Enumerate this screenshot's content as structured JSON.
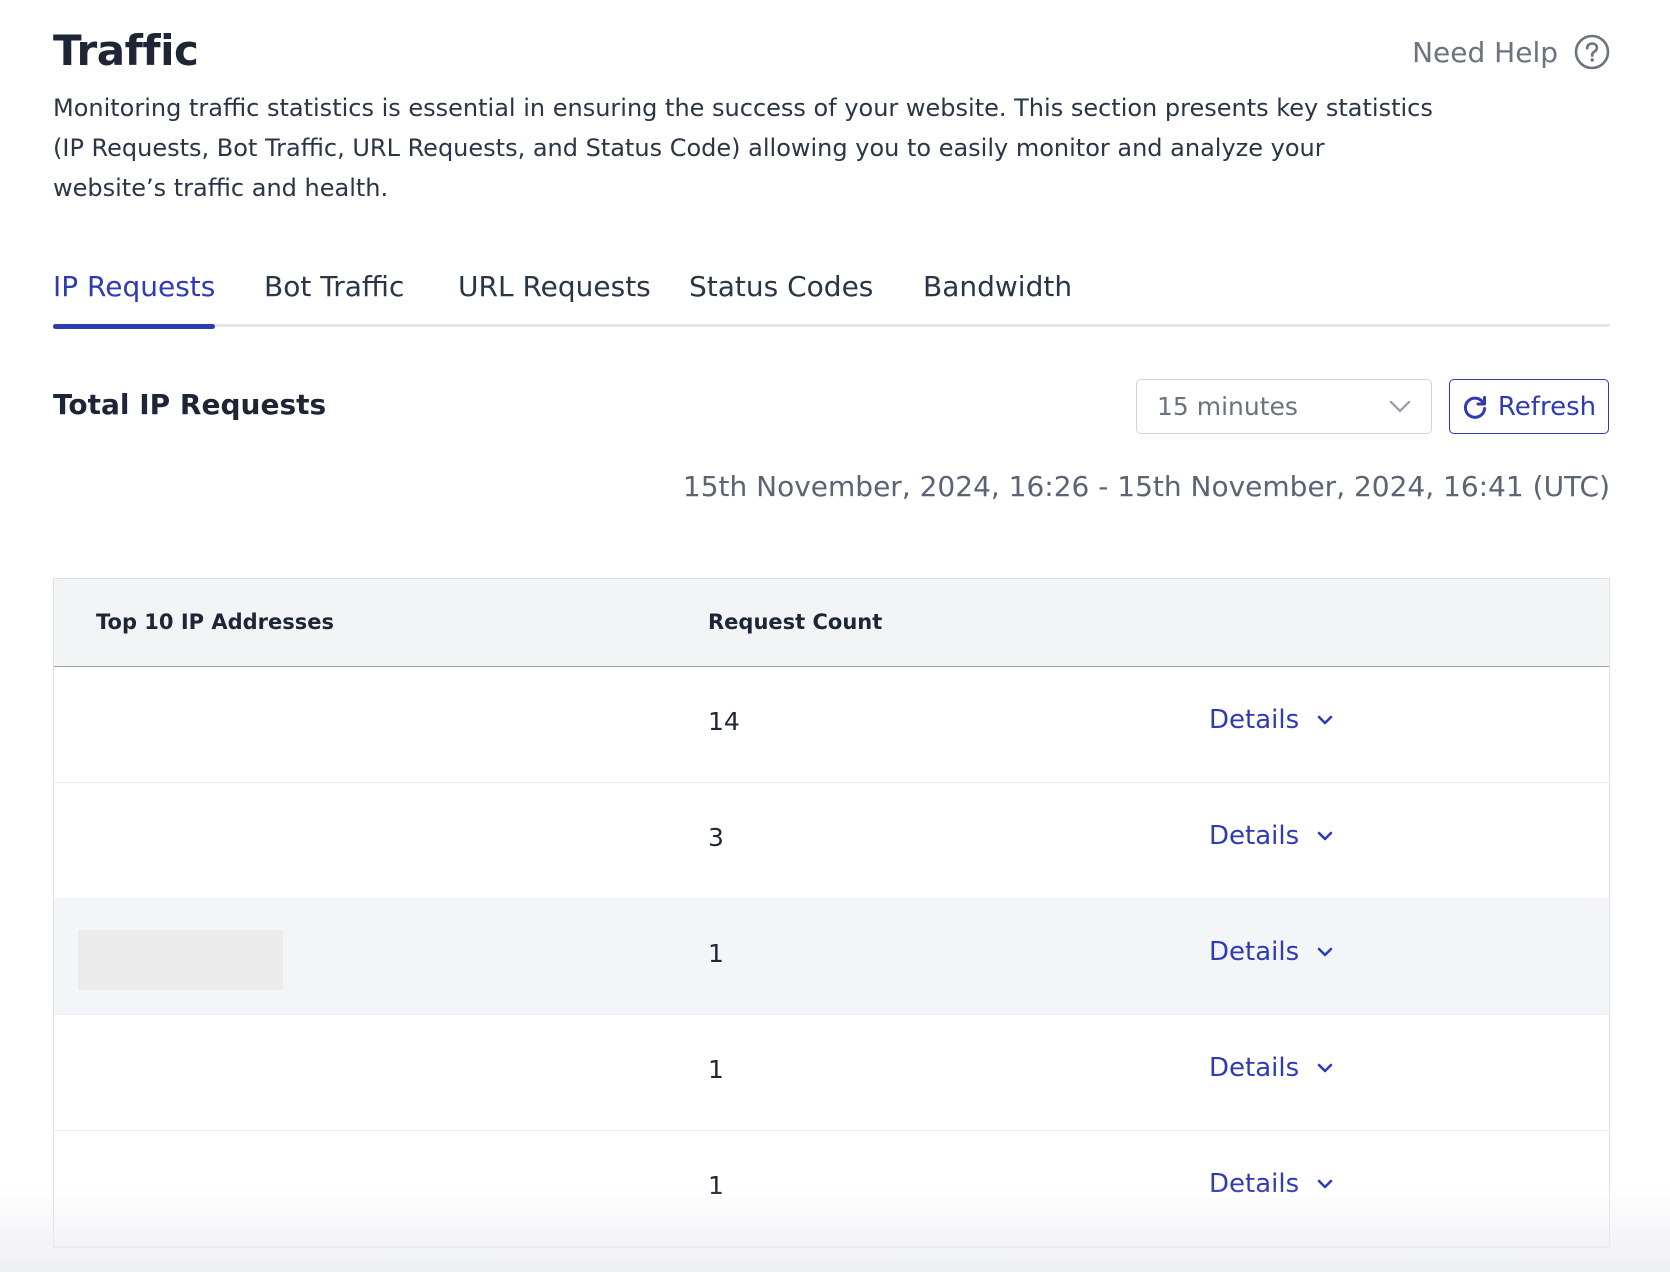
{
  "header": {
    "title": "Traffic",
    "help_label": "Need Help",
    "help_icon": "question-circle-icon"
  },
  "intro": "Monitoring traffic statistics is essential in ensuring the success of your website. This section presents key statistics (IP Requests, Bot Traffic, URL Requests, and Status Code) allowing you to easily monitor and analyze your website’s traffic and health.",
  "tabs": [
    {
      "label": "IP Requests",
      "active": true
    },
    {
      "label": "Bot Traffic",
      "active": false
    },
    {
      "label": "URL Requests",
      "active": false
    },
    {
      "label": "Status Codes",
      "active": false
    },
    {
      "label": "Bandwidth",
      "active": false
    }
  ],
  "section": {
    "title": "Total IP Requests",
    "time_select_value": "15 minutes",
    "refresh_label": "Refresh",
    "range": "15th November, 2024, 16:26 - 15th November, 2024, 16:41 (UTC)"
  },
  "table": {
    "headers": [
      "Top 10 IP Addresses",
      "Request Count"
    ],
    "details_label": "Details",
    "rows": [
      {
        "count": "14"
      },
      {
        "count": "3"
      },
      {
        "count": "1"
      },
      {
        "count": "1"
      },
      {
        "count": "1"
      }
    ]
  },
  "colors": {
    "accent": "#2f3bb3",
    "text": "#1e2636",
    "muted": "#6b7280",
    "header_bg": "#f3f4f6",
    "highlight_row": "#f4f5f9"
  }
}
